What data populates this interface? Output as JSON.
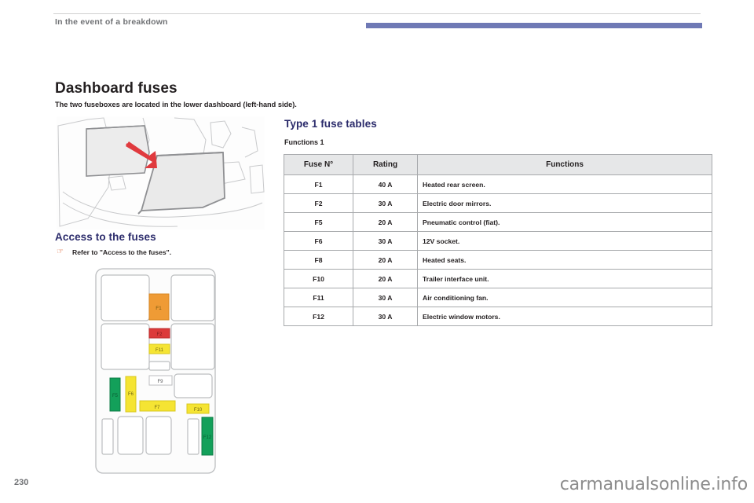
{
  "header": {
    "running_title": "In the event of a breakdown",
    "bar_color": "#6f79b5"
  },
  "left": {
    "title": "Dashboard fuses",
    "intro": "The two fuseboxes are located in the lower dashboard (left-hand side).",
    "section_title": "Access to the fuses",
    "bullet_icon": "pointer-hand-icon",
    "bullet_text": "Refer to \"Access to the fuses\"."
  },
  "right": {
    "title": "Type 1 fuse tables",
    "subtitle": "Functions 1",
    "table": {
      "columns": [
        "Fuse N°",
        "Rating",
        "Functions"
      ],
      "rows": [
        {
          "fuse": "F1",
          "rating": "40 A",
          "function": "Heated rear screen."
        },
        {
          "fuse": "F2",
          "rating": "30 A",
          "function": "Electric door mirrors."
        },
        {
          "fuse": "F5",
          "rating": "20 A",
          "function": "Pneumatic control (fiat)."
        },
        {
          "fuse": "F6",
          "rating": "30 A",
          "function": "12V socket."
        },
        {
          "fuse": "F8",
          "rating": "20 A",
          "function": "Heated seats."
        },
        {
          "fuse": "F10",
          "rating": "20 A",
          "function": "Trailer interface unit."
        },
        {
          "fuse": "F11",
          "rating": "30 A",
          "function": "Air conditioning fan."
        },
        {
          "fuse": "F12",
          "rating": "30 A",
          "function": "Electric window motors."
        }
      ]
    }
  },
  "diagram": {
    "fuses": [
      {
        "label": "F1",
        "color": "#ef9b35"
      },
      {
        "label": "F2",
        "color": "#dc3b3b"
      },
      {
        "label": "F11",
        "color": "#f5e433"
      },
      {
        "label": "F9",
        "color": "#ffffff"
      },
      {
        "label": "F5",
        "color": "#13a05a"
      },
      {
        "label": "F6",
        "color": "#f5e433"
      },
      {
        "label": "F7",
        "color": "#f5e433"
      },
      {
        "label": "F10",
        "color": "#f5e433"
      },
      {
        "label": "F12",
        "color": "#13a05a"
      }
    ]
  },
  "footer": {
    "page_number": "230",
    "watermark": "carmanualsonline.info"
  }
}
